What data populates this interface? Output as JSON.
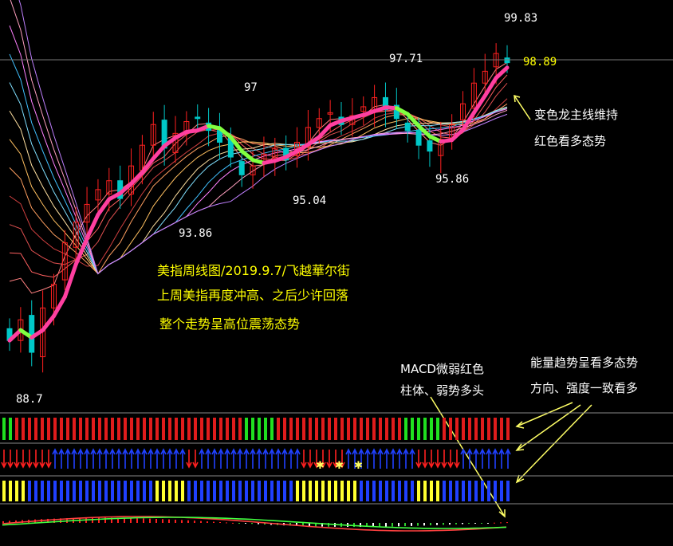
{
  "chart_data": {
    "type": "candlestick",
    "price_labels": {
      "high": "99.83",
      "current": "98.89",
      "peak_mid": "97.71",
      "peak_left": "97",
      "low_mid_1": "95.04",
      "low_mid_2": "95.86",
      "low_left": "93.86",
      "low_start": "88.7"
    },
    "annotations": {
      "title_line1": "美指周线图/2019.9.7/飞越華尔街",
      "title_line2": "上周美指再度冲高、之后少许回落",
      "title_line3": "整个走势呈高位震荡态势",
      "dragon_line1": "变色龙主线维持",
      "dragon_line2": "红色看多态势",
      "macd_line1": "MACD微弱红色",
      "macd_line2": "柱体、弱势多头",
      "energy_line1": "能量趋势呈看多态势",
      "energy_line2": "方向、强度一致看多"
    },
    "candles_close": [
      89.5,
      90.2,
      89.1,
      90.6,
      91.4,
      92.8,
      93.5,
      94.1,
      94.6,
      94.9,
      94.3,
      95.4,
      96.1,
      96.8,
      96.0,
      96.5,
      96.9,
      97.0,
      96.6,
      96.2,
      95.7,
      95.1,
      95.4,
      95.8,
      96.0,
      95.6,
      96.2,
      96.7,
      97.0,
      97.2,
      96.8,
      97.1,
      97.4,
      97.71,
      97.3,
      97.0,
      96.6,
      96.1,
      95.9,
      96.3,
      96.8,
      97.5,
      98.2,
      98.6,
      99.2,
      98.89
    ],
    "colors": {
      "up": "#ff2020",
      "down": "#00c8c8",
      "main_line_up": "#ff3fa0",
      "main_line_down": "#80ff40",
      "annotation": "#ffff00",
      "arrow": "#ffff66"
    }
  }
}
